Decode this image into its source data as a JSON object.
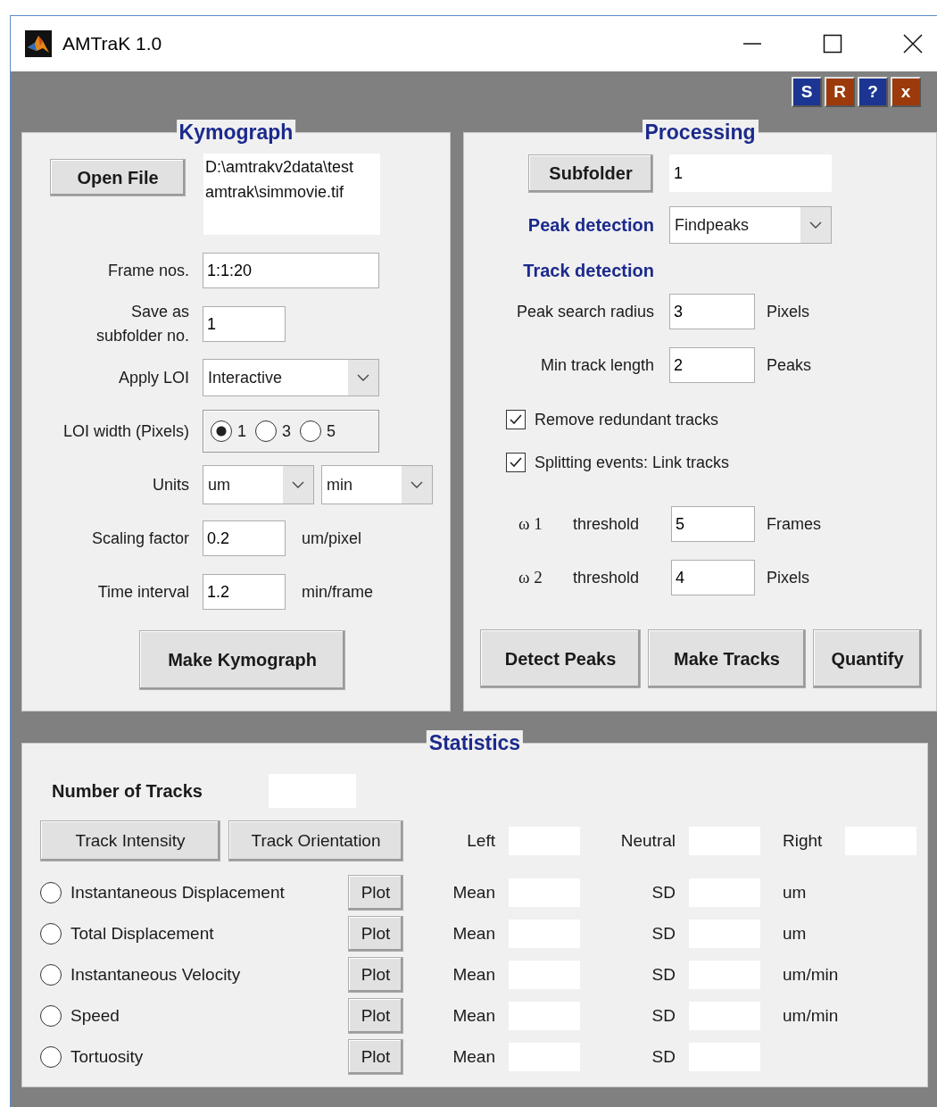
{
  "window": {
    "title": "AMTraK 1.0"
  },
  "toolbar_buttons": [
    {
      "label": "S",
      "color": "#1c3592"
    },
    {
      "label": "R",
      "color": "#9c3a0b"
    },
    {
      "label": "?",
      "color": "#1c3592"
    },
    {
      "label": "x",
      "color": "#9c3a0b"
    }
  ],
  "kymograph": {
    "title": "Kymograph",
    "open_file_button": "Open File",
    "file_path": "D:\\amtrakv2data\\test amtrak\\simmovie.tif",
    "fields": [
      {
        "kind": "wide_input",
        "label": "Frame nos.",
        "value": "1:1:20"
      },
      {
        "kind": "input",
        "label": "Save as\nsubfolder no.",
        "value": "1"
      },
      {
        "kind": "select",
        "label": "Apply  LOI",
        "value": "Interactive"
      },
      {
        "kind": "radio_group",
        "label": "LOI width (Pixels)",
        "options": [
          {
            "label": "1",
            "selected": true
          },
          {
            "label": "3",
            "selected": false
          },
          {
            "label": "5",
            "selected": false
          }
        ]
      },
      {
        "kind": "select_pair",
        "label": "Units",
        "values": [
          "um",
          "min"
        ]
      },
      {
        "kind": "input",
        "label": "Scaling factor",
        "value": "0.2",
        "unit": "um/pixel"
      },
      {
        "kind": "input",
        "label": "Time interval",
        "value": "1.2",
        "unit": "min/frame"
      }
    ],
    "make_button": "Make Kymograph"
  },
  "processing": {
    "title": "Processing",
    "subfolder_button": "Subfolder",
    "subfolder_value": "1",
    "peak_detection": {
      "label": "Peak detection",
      "value": "Findpeaks"
    },
    "track_detection_heading": "Track detection",
    "params": [
      {
        "label": "Peak search radius",
        "value": "3",
        "unit": "Pixels"
      },
      {
        "label": "Min track length",
        "value": "2",
        "unit": "Peaks"
      }
    ],
    "checkboxes": [
      {
        "label": "Remove redundant tracks",
        "checked": true
      },
      {
        "label": "Splitting events: Link tracks",
        "checked": true
      }
    ],
    "thresholds": [
      {
        "symbol": "ω 1",
        "label": "threshold",
        "value": "5",
        "unit": "Frames"
      },
      {
        "symbol": "ω 2",
        "label": "threshold",
        "value": "4",
        "unit": "Pixels"
      }
    ],
    "buttons": [
      "Detect Peaks",
      "Make Tracks",
      "Quantify"
    ]
  },
  "statistics": {
    "title": "Statistics",
    "number_of_tracks_label": "Number of Tracks",
    "buttons": [
      "Track Intensity",
      "Track Orientation"
    ],
    "orientation_labels": [
      "Left",
      "Neutral",
      "Right"
    ],
    "measures": [
      {
        "label": "Instantaneous Displacement",
        "selected": false,
        "plot_button": "Plot",
        "mean_label": "Mean",
        "sd_label": "SD",
        "unit": "um"
      },
      {
        "label": "Total Displacement",
        "selected": false,
        "plot_button": "Plot",
        "mean_label": "Mean",
        "sd_label": "SD",
        "unit": "um"
      },
      {
        "label": "Instantaneous Velocity",
        "selected": false,
        "plot_button": "Plot",
        "mean_label": "Mean",
        "sd_label": "SD",
        "unit": "um/min"
      },
      {
        "label": "Speed",
        "selected": false,
        "plot_button": "Plot",
        "mean_label": "Mean",
        "sd_label": "SD",
        "unit": "um/min"
      },
      {
        "label": "Tortuosity",
        "selected": false,
        "plot_button": "Plot",
        "mean_label": "Mean",
        "sd_label": "SD"
      }
    ]
  }
}
